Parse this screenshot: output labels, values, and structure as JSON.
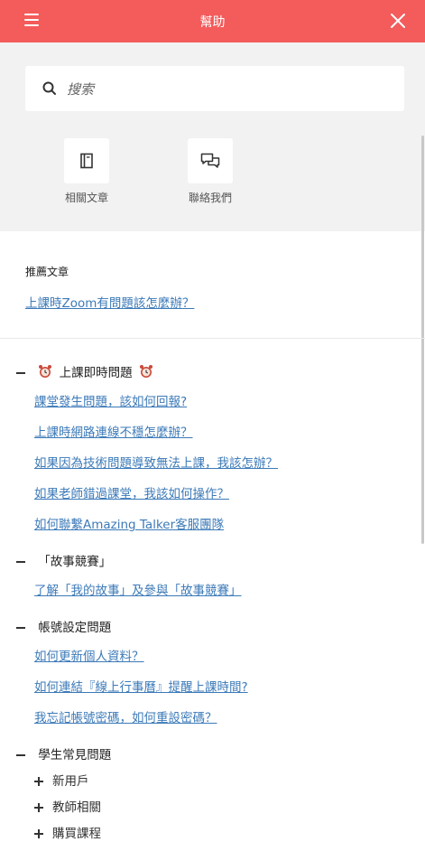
{
  "header": {
    "title": "幫助"
  },
  "search": {
    "placeholder": "搜索"
  },
  "quick_links": [
    {
      "label": "相關文章",
      "icon": "book-icon"
    },
    {
      "label": "聯絡我們",
      "icon": "chat-bubbles-icon"
    }
  ],
  "recommended": {
    "title": "推薦文章",
    "links": [
      "上課時Zoom有問題該怎麼辦？"
    ]
  },
  "sections": [
    {
      "title": "上課即時問題",
      "expanded": true,
      "icon": "alarm-clock-icon",
      "links": [
        "課堂發生問題，該如何回報?",
        "上課時網路連線不穩怎麼辦？",
        "如果因為技術問題導致無法上課，我該怎辦？",
        "如果老師錯過課堂，我該如何操作？",
        "如何聯繫Amazing Talker客服團隊"
      ]
    },
    {
      "title": "「故事競賽」",
      "expanded": true,
      "links": [
        "了解「我的故事」及參與「故事競賽」"
      ]
    },
    {
      "title": "帳號設定問題",
      "expanded": true,
      "links": [
        "如何更新個人資料？",
        "如何連結『線上行事曆』提醒上課時間?",
        "我忘記帳號密碼，如何重設密碼？"
      ]
    },
    {
      "title": "學生常見問題",
      "expanded": true,
      "subsections": [
        "新用戶",
        "教師相關",
        "購買課程"
      ]
    }
  ],
  "colors": {
    "header": "#f45b5b",
    "link": "#3c7ab8",
    "background": "#f2f2f2"
  }
}
